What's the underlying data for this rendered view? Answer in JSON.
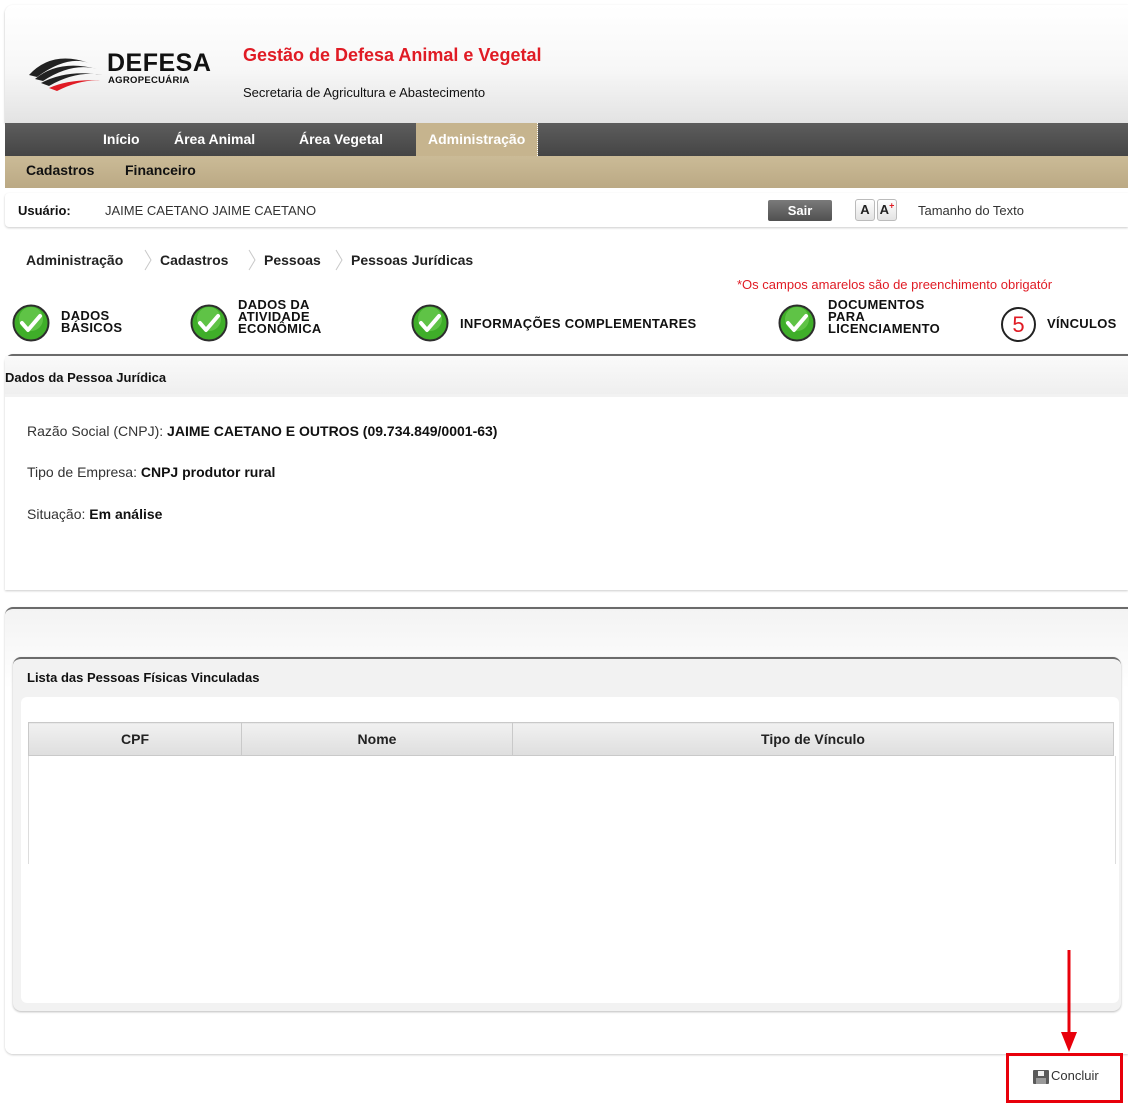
{
  "header": {
    "logo_word": "DEFESA",
    "logo_sub": "AGROPECUÁRIA",
    "title": "Gestão de Defesa Animal e Vegetal",
    "subtitle": "Secretaria de Agricultura e Abastecimento"
  },
  "main_nav": {
    "items": [
      "Início",
      "Área Animal",
      "Área Vegetal",
      "Administração"
    ],
    "active": "Administração"
  },
  "sub_nav": {
    "items": [
      "Cadastros",
      "Financeiro"
    ]
  },
  "user_bar": {
    "label": "Usuário:",
    "name": "JAIME CAETANO JAIME CAETANO",
    "logout": "Sair",
    "font_small": "A",
    "font_large": "A",
    "font_large_sup": "+",
    "font_label": "Tamanho do Texto"
  },
  "breadcrumb": [
    "Administração",
    "Cadastros",
    "Pessoas",
    "Pessoas Jurídicas"
  ],
  "required_note": "*Os campos amarelos são de preenchimento obrigatór",
  "steps": [
    {
      "lines": [
        "DADOS",
        "BÁSICOS"
      ],
      "status": "done"
    },
    {
      "lines": [
        "DADOS DA",
        "ATIVIDADE",
        "ECONÔMICA"
      ],
      "status": "done"
    },
    {
      "lines": [
        "INFORMAÇÕES COMPLEMENTARES"
      ],
      "status": "done"
    },
    {
      "lines": [
        "DOCUMENTOS",
        "PARA",
        "LICENCIAMENTO"
      ],
      "status": "done"
    },
    {
      "number": "5",
      "lines": [
        "VÍNCULOS"
      ],
      "status": "current"
    }
  ],
  "pessoa_juridica": {
    "section_title": "Dados da Pessoa Jurídica",
    "razao_label": "Razão Social (CNPJ):",
    "razao_value": "JAIME CAETANO E OUTROS (09.734.849/0001-63)",
    "tipo_label": "Tipo de Empresa:",
    "tipo_value": "CNPJ produtor rural",
    "situacao_label": "Situação:",
    "situacao_value": "Em análise"
  },
  "vinculadas": {
    "title": "Lista das Pessoas Físicas Vinculadas",
    "columns": [
      "CPF",
      "Nome",
      "Tipo de Vínculo"
    ],
    "rows": []
  },
  "actions": {
    "concluir": "Concluir"
  },
  "colors": {
    "brand_red": "#e01b24",
    "nav_dark": "#4f4f4f",
    "nav_tan": "#c6b48e",
    "check_green": "#3fae29",
    "highlight_red": "#e8000b"
  },
  "icons": {
    "step_done": "green-check-icon",
    "concluir": "save-disk-icon",
    "breadcrumb_separator": "chevron-right-icon"
  }
}
